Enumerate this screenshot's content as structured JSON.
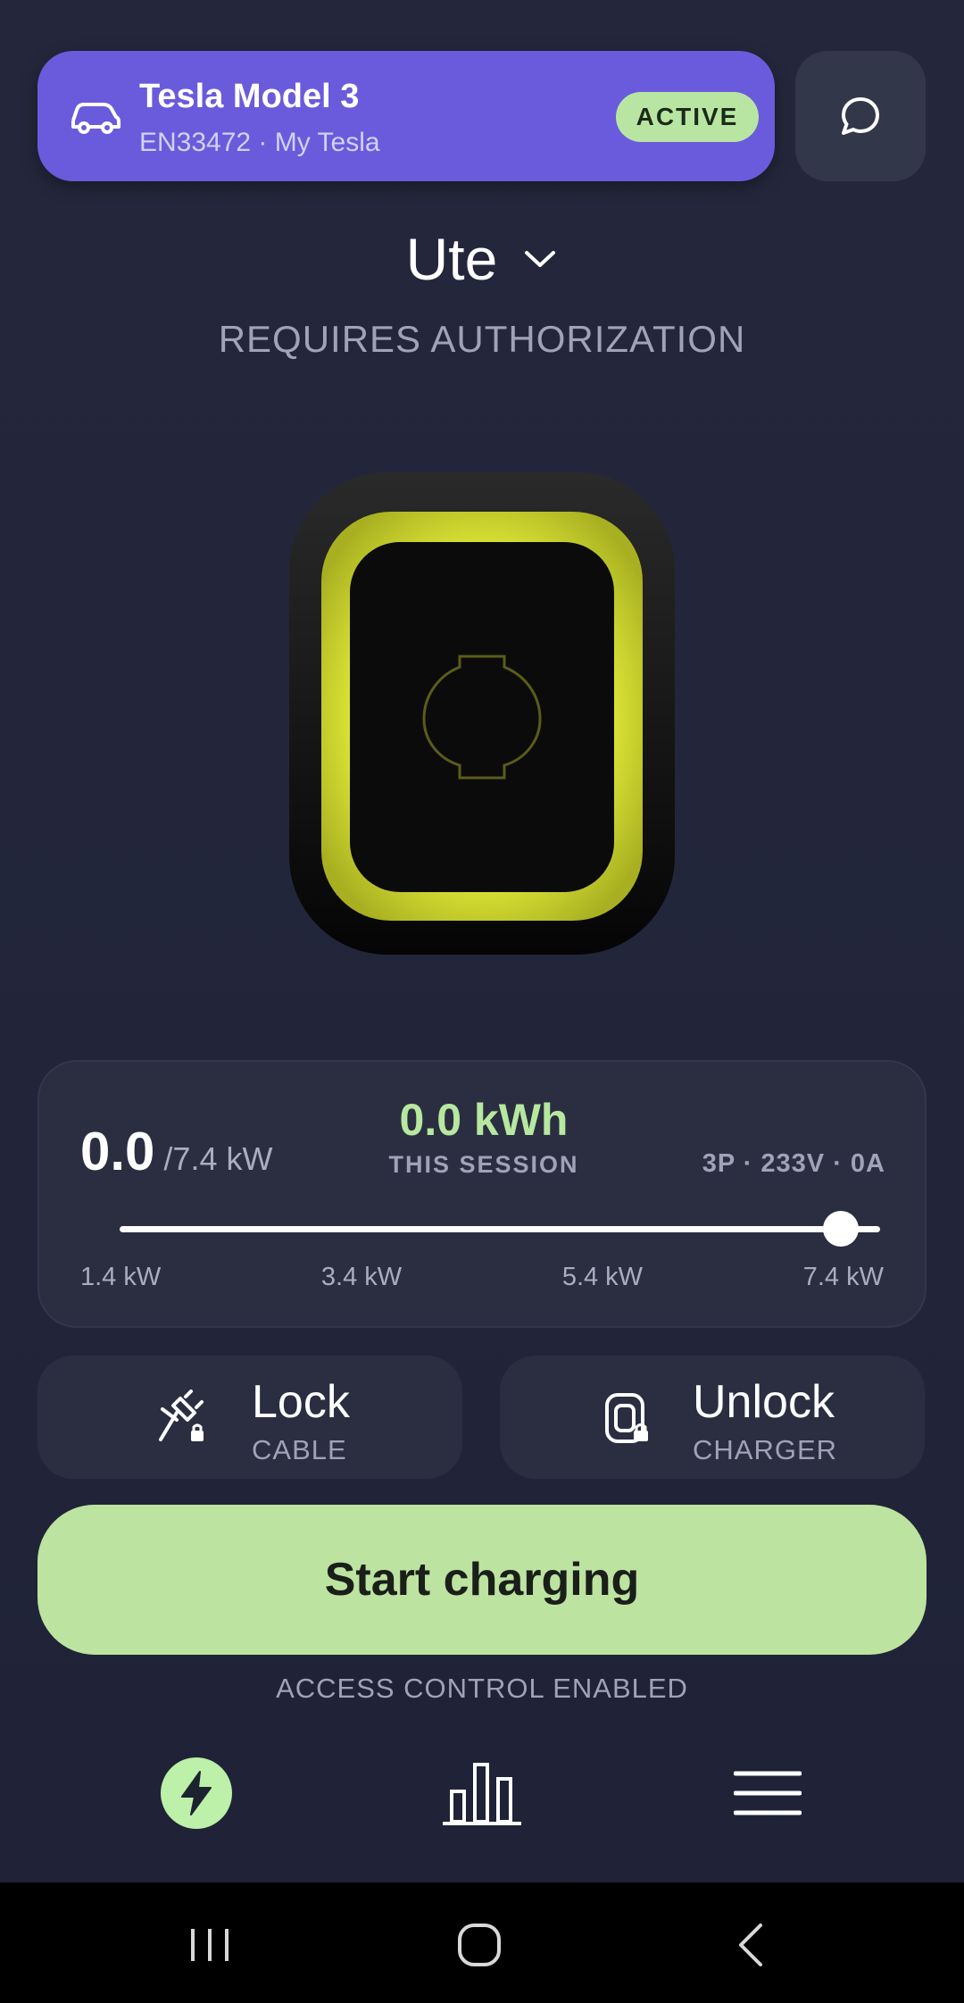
{
  "vehicle": {
    "name": "Tesla Model 3",
    "subtitle": "EN33472 · My Tesla",
    "status_badge": "ACTIVE",
    "icon": "car-icon"
  },
  "header": {
    "chat_icon": "chat-bubble-icon"
  },
  "charger": {
    "name": "Ute",
    "dropdown_icon": "chevron-down-icon",
    "status": "REQUIRES AUTHORIZATION",
    "ring_color": "#e6ef3a"
  },
  "power": {
    "current_value": "0.0",
    "max_label": "/7.4 kW",
    "session_energy": "0.0 kWh",
    "session_label": "THIS SESSION",
    "phase_info": "3P · 233V · 0A",
    "slider_level_fraction": 1.0,
    "slider_labels": [
      "1.4 kW",
      "3.4 kW",
      "5.4 kW",
      "7.4 kW"
    ]
  },
  "actions": {
    "lock": {
      "title": "Lock",
      "subtitle": "CABLE",
      "icon": "cable-lock-icon"
    },
    "unlock": {
      "title": "Unlock",
      "subtitle": "CHARGER",
      "icon": "charger-lock-icon"
    }
  },
  "start_button": {
    "label": "Start charging"
  },
  "access_note": "ACCESS CONTROL ENABLED",
  "bottom_nav": {
    "items": [
      {
        "name": "charge",
        "icon": "lightning-icon",
        "active": true
      },
      {
        "name": "statistics",
        "icon": "bar-chart-icon",
        "active": false
      },
      {
        "name": "menu",
        "icon": "hamburger-menu-icon",
        "active": false
      }
    ]
  },
  "colors": {
    "background": "#23263a",
    "vehicle_card": "#6a5bdc",
    "accent_green": "#b6e8a0",
    "start_button": "#bde3a0",
    "panel": "#2b2e41"
  }
}
